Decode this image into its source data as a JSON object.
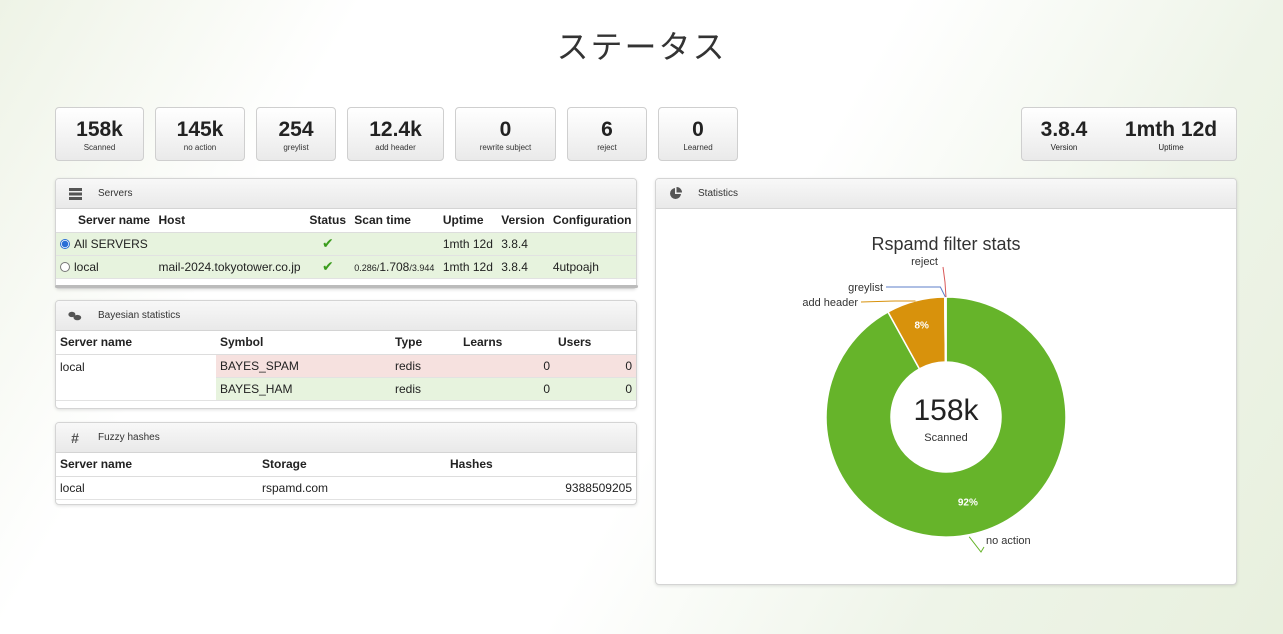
{
  "page_title": "ステータス",
  "stats": [
    {
      "value": "158k",
      "label": "Scanned"
    },
    {
      "value": "145k",
      "label": "no action"
    },
    {
      "value": "254",
      "label": "greylist"
    },
    {
      "value": "12.4k",
      "label": "add header"
    },
    {
      "value": "0",
      "label": "rewrite subject"
    },
    {
      "value": "6",
      "label": "reject"
    },
    {
      "value": "0",
      "label": "Learned"
    }
  ],
  "server_info": [
    {
      "value": "3.8.4",
      "label": "Version"
    },
    {
      "value": "1mth 12d",
      "label": "Uptime"
    }
  ],
  "servers_panel": {
    "title": "Servers",
    "icon": "server-icon",
    "columns": [
      "Server name",
      "Host",
      "Status",
      "Scan time",
      "Uptime",
      "Version",
      "Configuration"
    ],
    "rows": [
      {
        "name": "All SERVERS",
        "host": "",
        "status": "✔",
        "scan_time": "",
        "uptime": "1mth 12d",
        "version": "3.8.4",
        "config": "",
        "selected": true
      },
      {
        "name": "local",
        "host": "mail-2024.tokyotower.co.jp",
        "status": "✔",
        "scan_time_a": "0.286/",
        "scan_time_b": "1.708",
        "scan_time_c": "/3.944",
        "uptime": "1mth 12d",
        "version": "3.8.4",
        "config": "4utpoajh",
        "selected": false
      }
    ]
  },
  "bayes_panel": {
    "title": "Bayesian statistics",
    "icon": "coins-icon",
    "columns": [
      "Server name",
      "Symbol",
      "Type",
      "Learns",
      "Users"
    ],
    "server": "local",
    "rows": [
      {
        "symbol": "BAYES_SPAM",
        "type": "redis",
        "learns": "0",
        "users": "0"
      },
      {
        "symbol": "BAYES_HAM",
        "type": "redis",
        "learns": "0",
        "users": "0"
      }
    ]
  },
  "fuzzy_panel": {
    "title": "Fuzzy hashes",
    "icon": "hash-icon",
    "columns": [
      "Server name",
      "Storage",
      "Hashes"
    ],
    "rows": [
      {
        "server": "local",
        "storage": "rspamd.com",
        "hashes": "9388509205"
      }
    ]
  },
  "statistics_panel": {
    "title": "Statistics",
    "icon": "pie-chart-icon"
  },
  "chart_data": {
    "type": "pie",
    "title": "Rspamd filter stats",
    "center_value": "158k",
    "center_label": "Scanned",
    "categories": [
      "no action",
      "add header",
      "greylist",
      "reject"
    ],
    "values": [
      145000,
      12400,
      254,
      6
    ],
    "percent_labels": [
      "92%",
      "8%",
      "",
      ""
    ],
    "colors": [
      "#66b42a",
      "#d8920c",
      "#5c7fc9",
      "#d95858"
    ]
  }
}
